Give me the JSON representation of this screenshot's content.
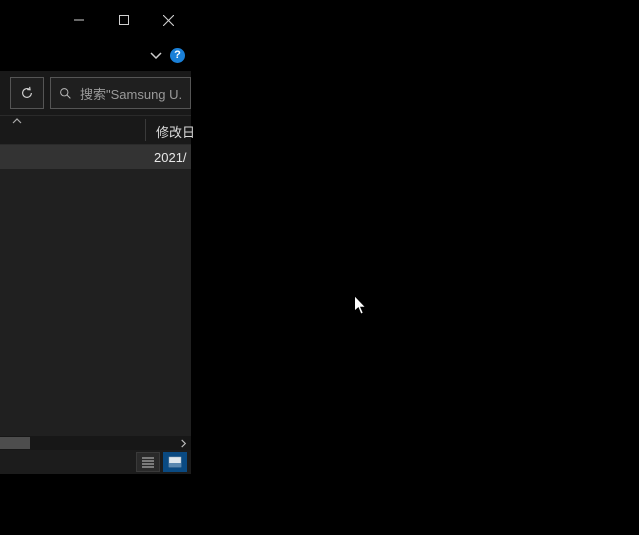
{
  "titlebar": {
    "minimize_tip": "最小化",
    "maximize_tip": "最大化",
    "close_tip": "关闭"
  },
  "ribbon": {
    "help_label": "?"
  },
  "toolbar": {
    "search_placeholder": "搜索\"Samsung U..."
  },
  "columns": {
    "modified_label": "修改日"
  },
  "rows": [
    {
      "date": "2021/"
    }
  ],
  "statusbar": {
    "view_details_tip": "details",
    "view_icons_tip": "icons"
  }
}
